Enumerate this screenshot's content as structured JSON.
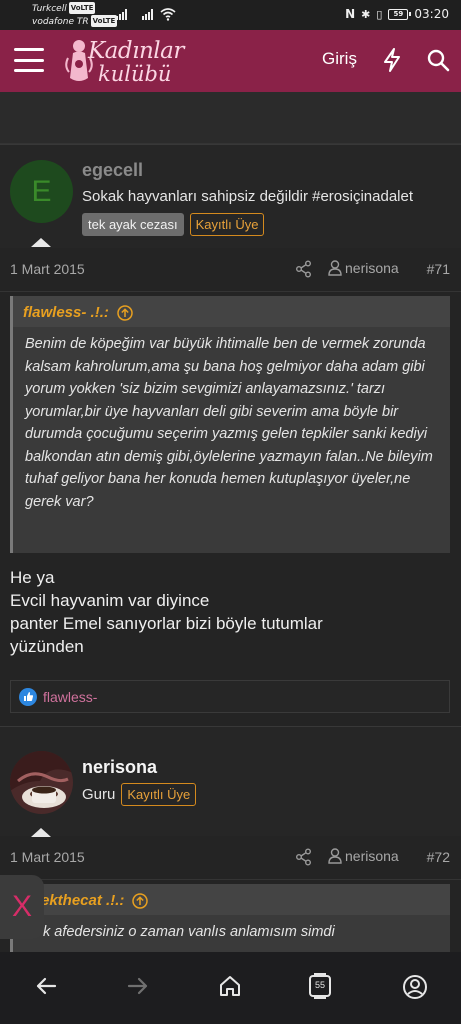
{
  "status": {
    "carrier1": "Turkcell",
    "carrier2": "vodafone TR",
    "volte": "VoLTE",
    "battery": "59",
    "time": "03:20"
  },
  "nav": {
    "logo_line1": "Kadınlar",
    "logo_line2": "kulübü",
    "login": "Giriş"
  },
  "post1": {
    "avatar_letter": "E",
    "username": "egecell",
    "signature": "Sokak hayvanları sahipsiz değildir #erosiçinadalet",
    "badge1": "tek ayak cezası",
    "badge2": "Kayıtlı Üye",
    "date": "1 Mart 2015",
    "author": "nerisona",
    "number": "#71",
    "quote_author": "flawless- .!.:",
    "quote_text": "Benim de köpeğim var büyük ihtimalle ben de vermek zorunda kalsam kahrolurum,ama şu bana hoş gelmiyor daha adam gibi yorum yokken 'siz bizim sevgimizi anlayamazsınız.' tarzı yorumlar,bir üye hayvanları deli gibi severim ama böyle bir durumda çocuğumu seçerim yazmış gelen tepkiler sanki kediyi balkondan atın demiş gibi,öylelerine yazmayın falan..Ne bileyim tuhaf geliyor bana her konuda hemen kutuplaşıyor üyeler,ne gerek var?",
    "text_lines": [
      "He ya",
      "Evcil hayvanim var diyince",
      "panter Emel sanıyorlar bizi böyle tutumlar",
      "yüzünden"
    ],
    "reaction_user": "flawless-"
  },
  "post2": {
    "username": "nerisona",
    "title": "Guru",
    "badge": "Kayıtlı Üye",
    "date": "1 Mart 2015",
    "author": "nerisona",
    "number": "#72",
    "quote_author": "ekthecat .!.:",
    "quote_text": "k afedersiniz o zaman vanlıs anlamısım simdi"
  },
  "overlay": {
    "close": "X"
  },
  "browser": {
    "tabs_count": "55"
  },
  "colors": {
    "brand": "#8a2248",
    "accent": "#e8a020",
    "link": "#d0729d"
  }
}
